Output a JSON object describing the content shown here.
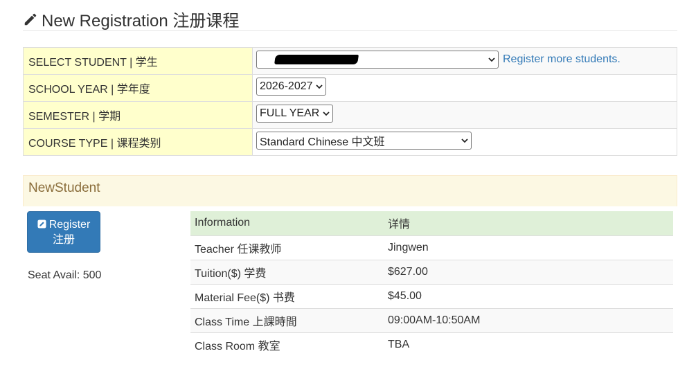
{
  "header": {
    "title": "New Registration 注册课程",
    "icon": "pencil-icon"
  },
  "form": {
    "student_label": "SELECT STUDENT | 学生",
    "student_value": "",
    "register_more_link": "Register more students.",
    "school_year_label": "SCHOOL YEAR | 学年度",
    "school_year_value": "2026-2027",
    "semester_label": "SEMESTER | 学期",
    "semester_value": "FULL YEAR",
    "course_type_label": "COURSE TYPE | 课程类别",
    "course_type_value": "Standard Chinese 中文班"
  },
  "student_panel": {
    "name": "NewStudent"
  },
  "register": {
    "label_en": "Register",
    "label_zh": "注册",
    "icon": "edit-icon",
    "seat_avail": "Seat Avail: 500"
  },
  "info": {
    "headers": [
      "Information",
      "详情"
    ],
    "rows": [
      [
        "Teacher 任课教师",
        "Jingwen"
      ],
      [
        "Tuition($) 学费",
        "$627.00"
      ],
      [
        "Material Fee($) 书费",
        "$45.00"
      ],
      [
        "Class Time 上課時間",
        "09:00AM-10:50AM"
      ],
      [
        "Class Room 教室",
        "TBA"
      ]
    ]
  },
  "colors": {
    "label_bg": "#ffffcc",
    "panel_bg": "#fcf8e3",
    "panel_text": "#8a6d3b",
    "button_bg": "#337ab7",
    "link": "#337ab7",
    "table_header_bg": "#dff0d8"
  }
}
